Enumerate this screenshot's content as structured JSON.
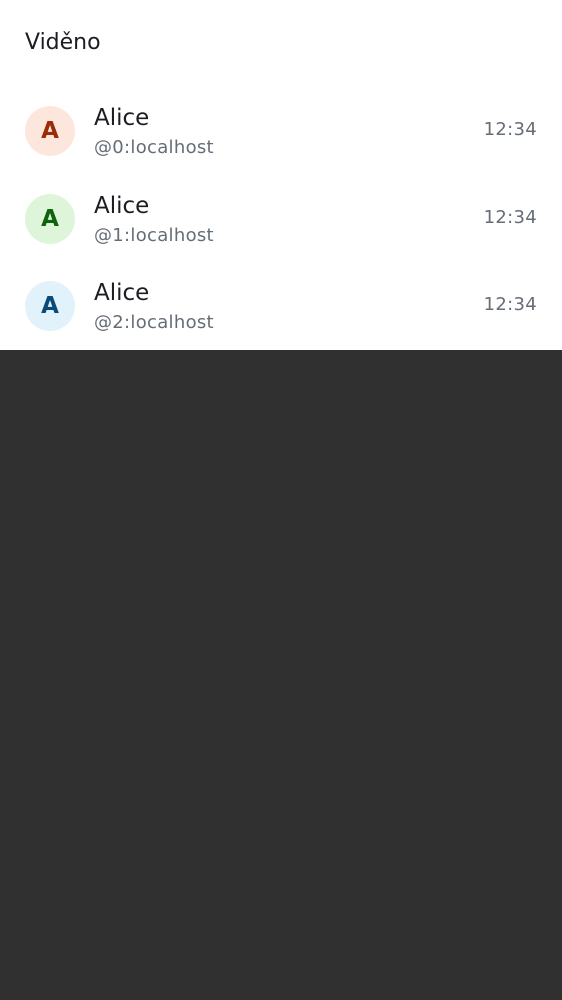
{
  "sheet": {
    "title": "Viděno"
  },
  "receipts": [
    {
      "initial": "A",
      "name": "Alice",
      "user_id": "@0:localhost",
      "time": "12:34",
      "avatar_bg": "#fde7dd",
      "avatar_fg": "#9b2c0a"
    },
    {
      "initial": "A",
      "name": "Alice",
      "user_id": "@1:localhost",
      "time": "12:34",
      "avatar_bg": "#def5da",
      "avatar_fg": "#11620e"
    },
    {
      "initial": "A",
      "name": "Alice",
      "user_id": "@2:localhost",
      "time": "12:34",
      "avatar_bg": "#e1f2fa",
      "avatar_fg": "#0a4a7a"
    }
  ]
}
